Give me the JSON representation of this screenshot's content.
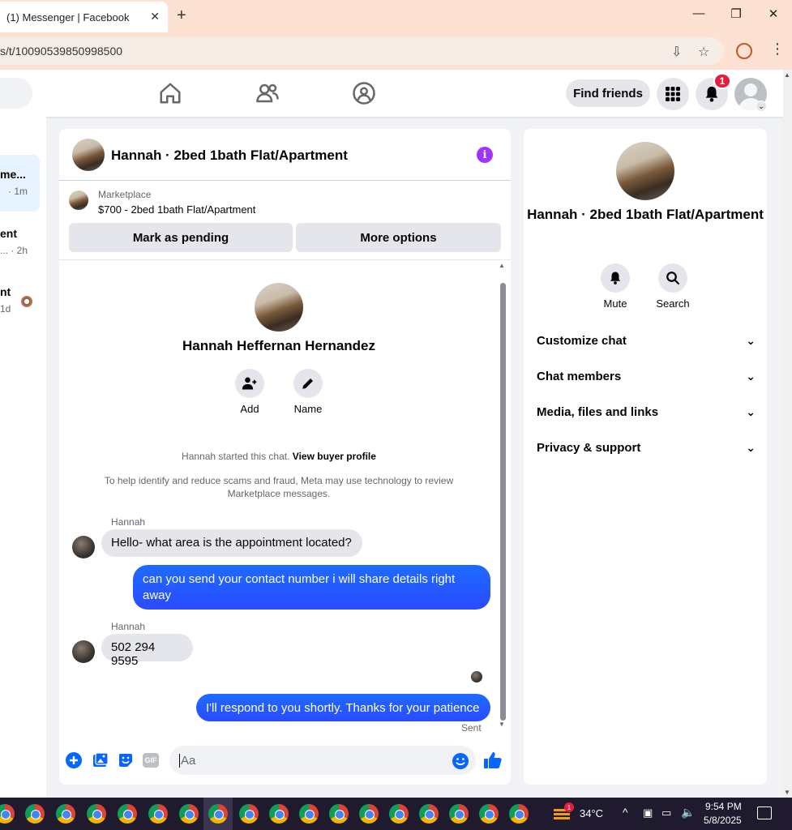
{
  "browser": {
    "tab_title": "(1) Messenger | Facebook",
    "url": "s/t/10090539850998500"
  },
  "header": {
    "find_friends": "Find friends",
    "notification_count": "1"
  },
  "chat_list": [
    {
      "name": "me...",
      "time": "· 1m"
    },
    {
      "name": "ent",
      "time": "... · 2h"
    },
    {
      "name": "nt",
      "time": "1d"
    }
  ],
  "chat": {
    "title": "Hannah · 2bed 1bath Flat/Apartment",
    "listing_source": "Marketplace",
    "listing_text": "$700 - 2bed 1bath Flat/Apartment",
    "mark_pending": "Mark as pending",
    "more_options": "More options",
    "profile_name": "Hannah Heffernan Hernandez",
    "add_label": "Add",
    "name_label": "Name",
    "started_text": "Hannah started this chat.",
    "view_buyer": "View buyer profile",
    "disclaimer": "To help identify and reduce scams and fraud, Meta may use technology to review Marketplace messages.",
    "messages": [
      {
        "sender": "Hannah",
        "text": "Hello- what area is the appointment located?"
      },
      {
        "text": "can you send your contact number i will share details right away"
      },
      {
        "sender": "Hannah",
        "text": "502 294 9595"
      },
      {
        "text": "I'll respond to you shortly. Thanks for your patience"
      }
    ],
    "sent_status": "Sent",
    "composer_placeholder": "Aa",
    "gif_label": "GIF"
  },
  "info": {
    "title": "Hannah · 2bed 1bath Flat/Apartment",
    "mute": "Mute",
    "search": "Search",
    "sections": [
      "Customize chat",
      "Chat members",
      "Media, files and links",
      "Privacy & support"
    ]
  },
  "taskbar": {
    "temperature": "34°C",
    "time": "9:54 PM",
    "date": "5/8/2025",
    "weather_badge": "1"
  },
  "colors": {
    "accent": "#0866ff",
    "out_bubble": "#2a4bff",
    "info_icon": "#a033ff",
    "badge": "#e41e3f"
  }
}
